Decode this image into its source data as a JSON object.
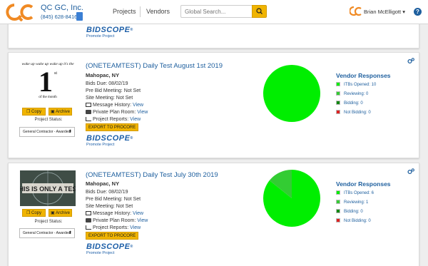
{
  "header": {
    "company_name": "QC GC, Inc.",
    "phone": "(845) 628-8416",
    "nav": {
      "projects": "Projects",
      "separator": "|",
      "vendors": "Vendors"
    },
    "search_placeholder": "Global Search...",
    "user_name": "Brian McElligott",
    "help_label": "?"
  },
  "top_card": {
    "bidscope_logo": "BIDSCOPE",
    "bidscope_sub": "Promote Project"
  },
  "projects": [
    {
      "title": "(ONETEAMTEST) Daily Test August 1st 2019",
      "location": "Mahopac, NY",
      "bids_due": "Bids Due: 08/02/19",
      "pre_bid": "Pre Bid Meeting: Not Set",
      "site_meeting": "Site Meeting: Not Set",
      "message_history_label": "Message History:",
      "message_history_link": "View",
      "plan_room_label": "Private Plan Room:",
      "plan_room_link": "View",
      "reports_label": "Project Reports:",
      "reports_link": "View",
      "export_label": "EXPORT TO PROCORE",
      "copy_label": "Copy",
      "archive_label": "Archive",
      "status_label": "Project Status:",
      "status_value": "General Contractor - Awarded",
      "bidscope_logo": "BIDSCOPE",
      "bidscope_sub": "Promote Project",
      "thumbnail_text": {
        "top": "wake up wake up wake up it's the",
        "big": "1",
        "sup": "st",
        "bottom": "of the month"
      },
      "vendor_responses_title": "Vendor Responses",
      "responses": [
        {
          "label": "ITBs Opened: 10",
          "color": "#00ee00"
        },
        {
          "label": "Reviewing: 0",
          "color": "#33cc33"
        },
        {
          "label": "Bidding: 0",
          "color": "#118811"
        },
        {
          "label": "Not Bidding: 0",
          "color": "#dd2222"
        }
      ],
      "pie": {
        "opened": 10,
        "reviewing": 0,
        "bidding": 0,
        "not_bidding": 0
      }
    },
    {
      "title": "(ONETEAMTEST) Daily Test July 30th 2019",
      "location": "Mahopac, NY",
      "bids_due": "Bids Due: 08/02/19",
      "pre_bid": "Pre Bid Meeting: Not Set",
      "site_meeting": "Site Meeting: Not Set",
      "message_history_label": "Message History:",
      "message_history_link": "View",
      "plan_room_label": "Private Plan Room:",
      "plan_room_link": "View",
      "reports_label": "Project Reports:",
      "reports_link": "View",
      "export_label": "EXPORT TO PROCORE",
      "copy_label": "Copy",
      "archive_label": "Archive",
      "status_label": "Project Status:",
      "status_value": "General Contractor - Awarded",
      "bidscope_logo": "BIDSCOPE",
      "bidscope_sub": "Promote Project",
      "thumbnail_text": {
        "main": "THIS IS ONLY A TEST"
      },
      "vendor_responses_title": "Vendor Responses",
      "responses": [
        {
          "label": "ITBs Opened: 6",
          "color": "#00ee00"
        },
        {
          "label": "Reviewing: 1",
          "color": "#33cc33"
        },
        {
          "label": "Bidding: 0",
          "color": "#118811"
        },
        {
          "label": "Not Bidding: 0",
          "color": "#dd2222"
        }
      ],
      "pie": {
        "opened": 6,
        "reviewing": 1,
        "bidding": 0,
        "not_bidding": 0
      }
    }
  ]
}
